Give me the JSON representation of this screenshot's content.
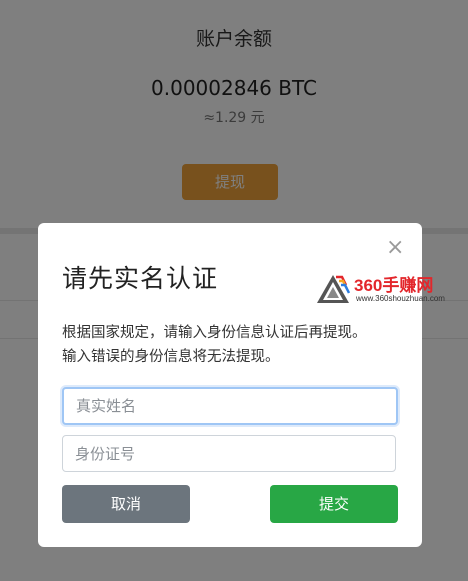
{
  "background": {
    "balance_title": "账户余额",
    "balance_amount": "0.00002846 BTC",
    "balance_fiat": "≈1.29 元",
    "withdraw_label": "提现",
    "accent_color": "#f0a33b"
  },
  "modal": {
    "close_glyph": "×",
    "title": "请先实名认证",
    "description_line1": "根据国家规定，请输入身份信息认证后再提现。",
    "description_line2": "输入错误的身份信息将无法提现。",
    "name_placeholder": "真实姓名",
    "id_placeholder": "身份证号",
    "cancel_label": "取消",
    "submit_label": "提交",
    "cancel_color": "#6c757d",
    "submit_color": "#28a745"
  },
  "watermark": {
    "brand": "360手赚网",
    "url": "www.360shouzhuan.com"
  }
}
